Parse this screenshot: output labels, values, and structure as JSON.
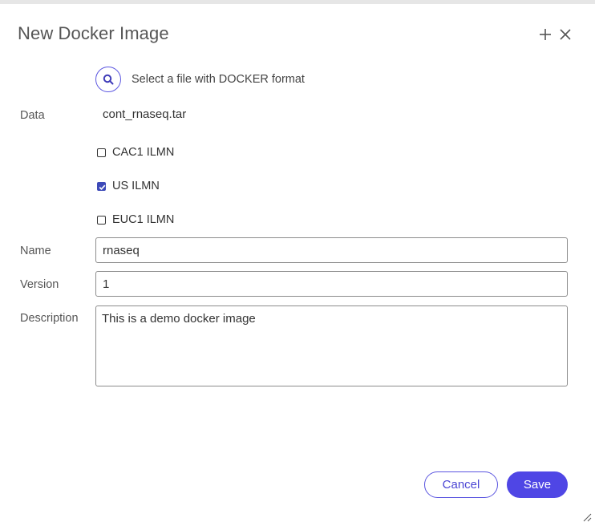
{
  "dialog": {
    "title": "New Docker Image",
    "add_icon": "plus-icon",
    "close_icon": "close-icon"
  },
  "file_picker": {
    "icon": "search-icon",
    "hint": "Select a file with DOCKER format"
  },
  "data": {
    "label": "Data",
    "value": "cont_rnaseq.tar"
  },
  "regions": [
    {
      "label": "CAC1 ILMN",
      "checked": false
    },
    {
      "label": "US ILMN",
      "checked": true
    },
    {
      "label": "EUC1 ILMN",
      "checked": false
    }
  ],
  "name": {
    "label": "Name",
    "value": "rnaseq"
  },
  "version": {
    "label": "Version",
    "value": "1"
  },
  "description": {
    "label": "Description",
    "value": "This is a demo docker image"
  },
  "actions": {
    "cancel_label": "Cancel",
    "save_label": "Save"
  },
  "colors": {
    "accent": "#4f46e5",
    "checkbox_checked": "#3d4ab8"
  }
}
